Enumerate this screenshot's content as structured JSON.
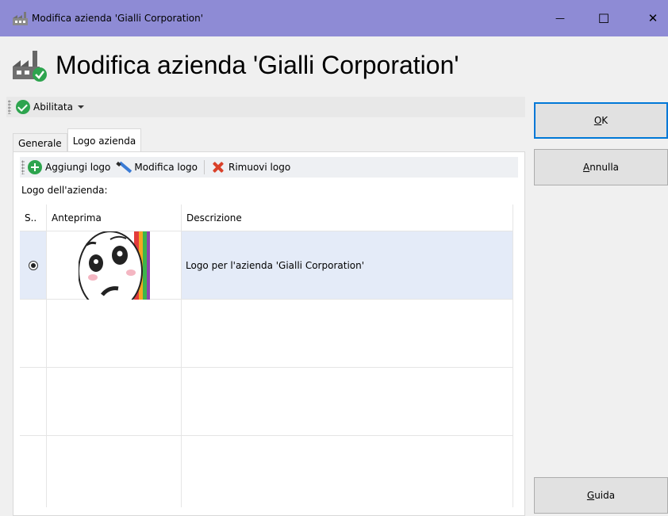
{
  "window": {
    "title": "Modifica azienda 'Gialli Corporation'",
    "minimize_glyph": "—",
    "maximize_glyph": "☐",
    "close_glyph": "✕"
  },
  "header": {
    "title": "Modifica azienda 'Gialli Corporation'"
  },
  "top_toolbar": {
    "status_label": "Abilitata"
  },
  "tabs": [
    {
      "label": "Generale",
      "active": false
    },
    {
      "label": "Logo azienda",
      "active": true
    }
  ],
  "logo_toolbar": {
    "add_label": "Aggiungi logo",
    "edit_label": "Modifica logo",
    "remove_label": "Rimuovi logo"
  },
  "logo_section_label": "Logo dell'azienda:",
  "grid": {
    "columns": [
      "S..",
      "Anteprima",
      "Descrizione"
    ],
    "rows": [
      {
        "selected": true,
        "description": "Logo per l'azienda 'Gialli Corporation'"
      }
    ]
  },
  "buttons": {
    "ok": {
      "accel": "O",
      "rest": "K"
    },
    "cancel": {
      "accel": "A",
      "rest": "nnulla"
    },
    "help": {
      "accel": "G",
      "rest": "uida"
    }
  },
  "colors": {
    "titlebar": "#8e8bd5",
    "accent": "#0078d7",
    "selected_row": "#e4ebf8",
    "check_green": "#2da44e",
    "remove_red": "#d9412a"
  }
}
